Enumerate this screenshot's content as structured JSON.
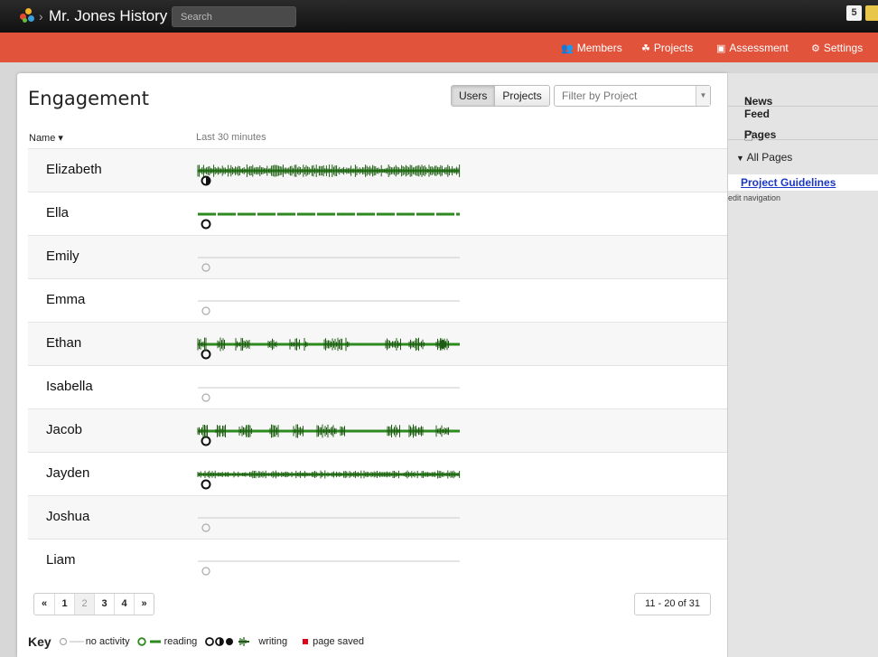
{
  "app": {
    "title": "Mr. Jones History",
    "search_placeholder": "Search",
    "notif_count": "5"
  },
  "nav": {
    "members": "Members",
    "projects": "Projects",
    "assessment": "Assessment",
    "settings": "Settings"
  },
  "panel": {
    "title": "Engagement",
    "toggle": {
      "users": "Users",
      "projects": "Projects"
    },
    "filter_placeholder": "Filter by Project",
    "col_name": "Name ▾",
    "col_activity": "Last 30 minutes"
  },
  "users": [
    {
      "name": "Elizabeth",
      "status": "writing-half",
      "activity": "writing-dense"
    },
    {
      "name": "Ella",
      "status": "reading",
      "activity": "reading-dashed"
    },
    {
      "name": "Emily",
      "status": "none",
      "activity": "none"
    },
    {
      "name": "Emma",
      "status": "none",
      "activity": "none"
    },
    {
      "name": "Ethan",
      "status": "reading",
      "activity": "mixed-1"
    },
    {
      "name": "Isabella",
      "status": "none",
      "activity": "none"
    },
    {
      "name": "Jacob",
      "status": "reading",
      "activity": "mixed-2"
    },
    {
      "name": "Jayden",
      "status": "reading",
      "activity": "writing-dense-2"
    },
    {
      "name": "Joshua",
      "status": "none",
      "activity": "none"
    },
    {
      "name": "Liam",
      "status": "none",
      "activity": "none"
    }
  ],
  "pager": {
    "pages": [
      "«",
      "1",
      "2",
      "3",
      "4",
      "»"
    ],
    "current": "2",
    "range": "11 - 20 of 31"
  },
  "key": {
    "label": "Key",
    "no_activity": "no activity",
    "reading": "reading",
    "writing": "writing",
    "page_saved": "page saved"
  },
  "sidebar": {
    "news_feed": "News Feed",
    "pages": "Pages",
    "all_pages": "All Pages",
    "link": "Project Guidelines",
    "edit_nav": "edit navigation"
  },
  "colors": {
    "accent": "#e2533c",
    "reading": "#2d8a1e",
    "writing": "#1d5c12",
    "saved": "#e0001a"
  }
}
